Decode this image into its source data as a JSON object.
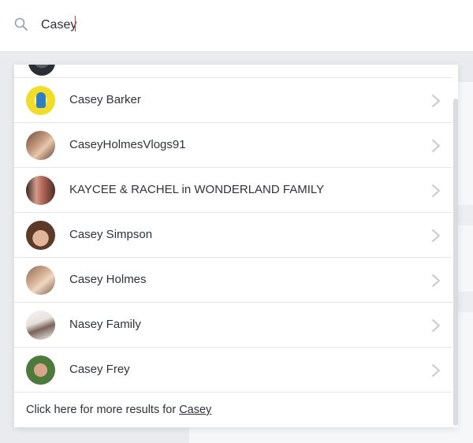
{
  "search": {
    "value": "Casey",
    "placeholder": ""
  },
  "results": [
    {
      "name": "Casey Barker",
      "avatar_icon": "avatar-yellow-icon"
    },
    {
      "name": "CaseyHolmesVlogs91",
      "avatar_icon": "avatar-photo-icon"
    },
    {
      "name": "KAYCEE & RACHEL in WONDERLAND FAMILY",
      "avatar_icon": "avatar-photo-icon"
    },
    {
      "name": "Casey Simpson",
      "avatar_icon": "avatar-photo-icon"
    },
    {
      "name": "Casey Holmes",
      "avatar_icon": "avatar-photo-icon"
    },
    {
      "name": "Nasey Family",
      "avatar_icon": "avatar-photo-icon"
    },
    {
      "name": "Casey Frey",
      "avatar_icon": "avatar-photo-icon"
    }
  ],
  "more_results": {
    "prefix": "Click here for more results for ",
    "link": "Casey"
  },
  "colors": {
    "caret": "#e23b3b",
    "divider": "#e4e6ea",
    "chevron": "#c6c9ce",
    "search_icon": "#9aa0a8"
  }
}
